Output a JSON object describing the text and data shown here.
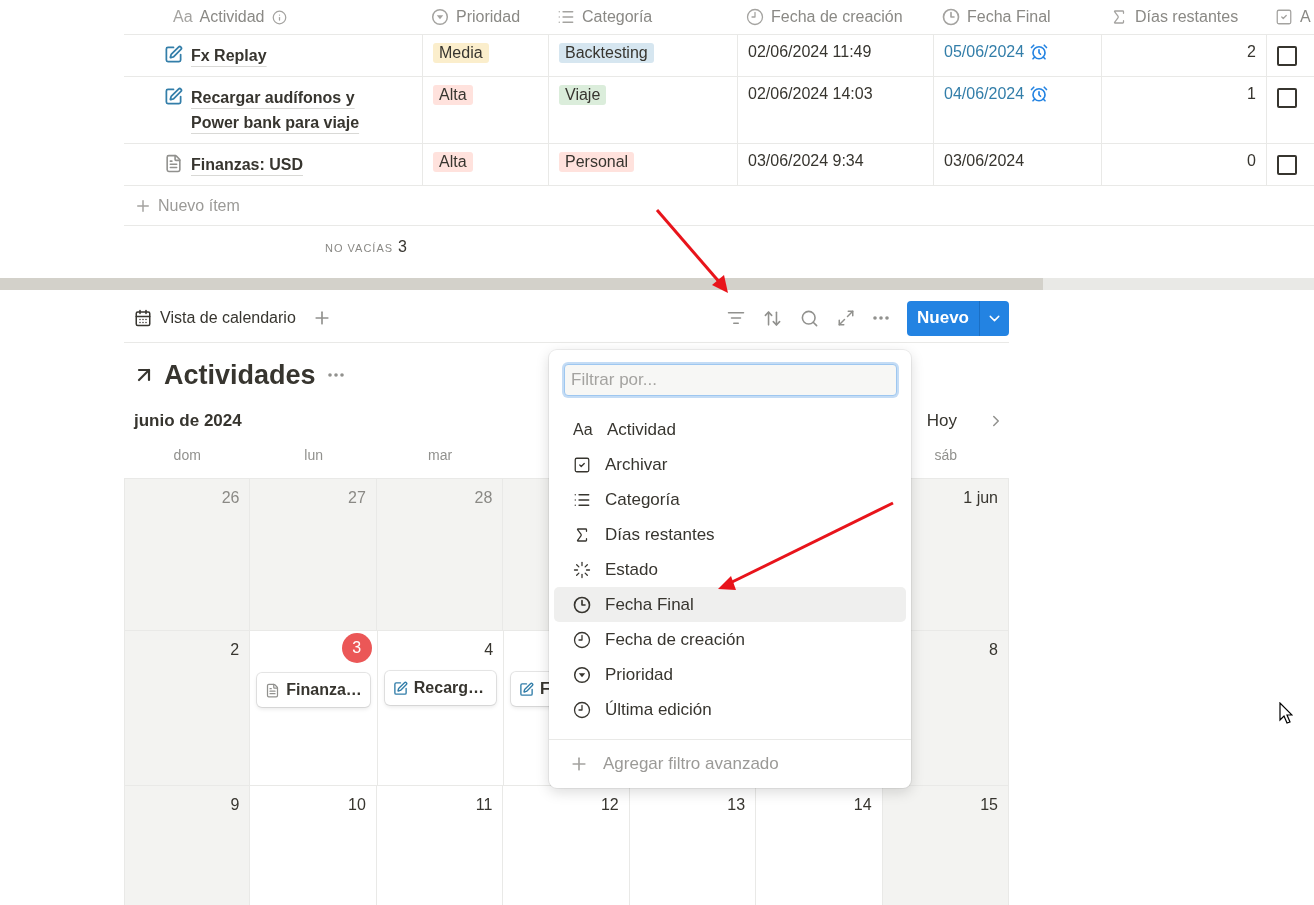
{
  "table": {
    "columns": [
      {
        "label": "Actividad",
        "kind": "title",
        "glyph": "Aa",
        "info": true
      },
      {
        "label": "Prioridad",
        "kind": "select"
      },
      {
        "label": "Categoría",
        "kind": "multiselect"
      },
      {
        "label": "Fecha de creación",
        "kind": "created"
      },
      {
        "label": "Fecha Final",
        "kind": "date"
      },
      {
        "label": "Días restantes",
        "kind": "formula"
      },
      {
        "label": "A",
        "kind": "checkbox"
      }
    ],
    "rows": [
      {
        "kind": "edit",
        "title": "Fx Replay",
        "priority": {
          "label": "Media",
          "color": "#fbeecc"
        },
        "category": {
          "label": "Backtesting",
          "color": "#d6e6f0"
        },
        "created": "02/06/2024 11:49",
        "due": "05/06/2024",
        "reminder": true,
        "days_left": "2",
        "checked": false
      },
      {
        "kind": "edit",
        "title": "Recargar audífonos y Power bank para viaje",
        "priority": {
          "label": "Alta",
          "color": "#ffe2dd"
        },
        "category": {
          "label": "Viaje",
          "color": "#dbeddb"
        },
        "created": "02/06/2024 14:03",
        "due": "04/06/2024",
        "reminder": true,
        "days_left": "1",
        "checked": false
      },
      {
        "kind": "page",
        "title": "Finanzas: USD",
        "priority": {
          "label": "Alta",
          "color": "#ffe2dd"
        },
        "category": {
          "label": "Personal",
          "color": "#ffe2dd"
        },
        "created": "03/06/2024 9:34",
        "due": "03/06/2024",
        "reminder": false,
        "days_left": "0",
        "checked": false
      }
    ],
    "new_item": "Nuevo ítem",
    "footer": {
      "label": "NO VACÍAS",
      "count": "3"
    }
  },
  "calendar": {
    "view_tab": "Vista de calendario",
    "new_button": "Nuevo",
    "title": "Actividades",
    "month": "junio de 2024",
    "today_button": "Hoy",
    "weekdays": [
      "dom",
      "lun",
      "mar",
      "sáb"
    ],
    "weeks": [
      {
        "days": [
          {
            "day": "26",
            "muted": true,
            "shaded": true,
            "today": false
          },
          {
            "day": "27",
            "muted": true,
            "shaded": true,
            "today": false
          },
          {
            "day": "28",
            "muted": true,
            "shaded": true,
            "today": false
          },
          {
            "shaded": true
          },
          {
            "day": "1 jun",
            "muted": false,
            "shaded": true,
            "today": false
          }
        ]
      },
      {
        "days": [
          {
            "day": "2",
            "muted": false,
            "shaded": true,
            "today": false
          },
          {
            "day": "3",
            "muted": false,
            "shaded": false,
            "today": true,
            "events": [
              {
                "kind": "page",
                "title": "Finanza…"
              }
            ]
          },
          {
            "day": "4",
            "muted": false,
            "shaded": false,
            "today": false,
            "events": [
              {
                "kind": "edit",
                "title": "Recarg…"
              }
            ]
          },
          {
            "shaded": false,
            "events": [
              {
                "kind": "edit",
                "title": "F"
              }
            ]
          },
          {
            "day": "8",
            "muted": false,
            "shaded": true,
            "today": false
          }
        ]
      },
      {
        "days": [
          {
            "day": "9",
            "muted": false,
            "shaded": true,
            "today": false
          },
          {
            "day": "10",
            "muted": false,
            "shaded": false,
            "today": false
          },
          {
            "day": "11",
            "muted": false,
            "shaded": false,
            "today": false
          },
          {
            "day": "12",
            "muted": false,
            "shaded": false,
            "today": false
          },
          {
            "day": "13",
            "muted": false,
            "shaded": false,
            "today": false
          },
          {
            "day": "14",
            "muted": false,
            "shaded": false,
            "today": false
          },
          {
            "day": "15",
            "muted": false,
            "shaded": true,
            "today": false
          }
        ]
      }
    ]
  },
  "filter_menu": {
    "placeholder": "Filtrar por...",
    "items": [
      {
        "label": "Actividad",
        "kind": "title",
        "glyph": "Aa",
        "selected": false
      },
      {
        "label": "Archivar",
        "kind": "checkbox",
        "selected": false
      },
      {
        "label": "Categoría",
        "kind": "multiselect",
        "selected": false
      },
      {
        "label": "Días restantes",
        "kind": "formula",
        "selected": false
      },
      {
        "label": "Estado",
        "kind": "status",
        "selected": false
      },
      {
        "label": "Fecha Final",
        "kind": "date",
        "selected": true
      },
      {
        "label": "Fecha de creación",
        "kind": "created",
        "selected": false
      },
      {
        "label": "Prioridad",
        "kind": "select",
        "selected": false
      },
      {
        "label": "Última edición",
        "kind": "edited",
        "selected": false
      }
    ],
    "advanced": "Agregar filtro avanzado"
  }
}
